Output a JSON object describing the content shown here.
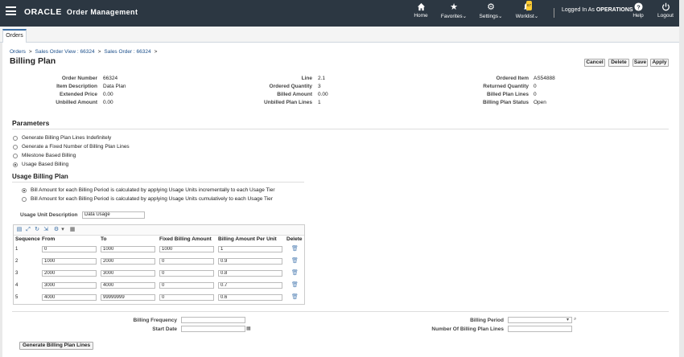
{
  "header": {
    "app_brand": "ORACLE",
    "app_name": "Order Management",
    "nav": [
      {
        "label": "Home",
        "icon": "home-icon"
      },
      {
        "label": "Favorites",
        "icon": "star-icon"
      },
      {
        "label": "Settings",
        "icon": "gear-icon"
      },
      {
        "label": "Worklist",
        "icon": "bell-icon",
        "badge": "67"
      },
      {
        "label": "Help",
        "icon": "help-icon"
      },
      {
        "label": "Logout",
        "icon": "power-icon"
      }
    ],
    "logged_in_prefix": "Logged In As",
    "logged_in_user": "OPERATIONS"
  },
  "tabs": [
    {
      "label": "Orders"
    }
  ],
  "breadcrumb": [
    "Orders",
    "Sales Order View : 66324",
    "Sales Order : 66324"
  ],
  "page_title": "Billing Plan",
  "toolbar": {
    "cancel": "Cancel",
    "delete": "Delete",
    "save": "Save",
    "apply": "Apply"
  },
  "info": {
    "col1": [
      {
        "label": "Order Number",
        "value": "66324"
      },
      {
        "label": "Item Description",
        "value": "Data Plan"
      },
      {
        "label": "Extended Price",
        "value": "0.00"
      },
      {
        "label": "Unbilled Amount",
        "value": "0.00"
      }
    ],
    "col2": [
      {
        "label": "Line",
        "value": "2.1"
      },
      {
        "label": "Ordered Quantity",
        "value": "3"
      },
      {
        "label": "Billed Amount",
        "value": "0.00"
      },
      {
        "label": "Unbilled Plan Lines",
        "value": "1"
      }
    ],
    "col3": [
      {
        "label": "Ordered Item",
        "value": "AS54888"
      },
      {
        "label": "Returned Quantity",
        "value": "0"
      },
      {
        "label": "Billed Plan Lines",
        "value": "0"
      },
      {
        "label": "Billing Plan Status",
        "value": "Open"
      }
    ]
  },
  "parameters": {
    "title": "Parameters",
    "options": [
      {
        "label": "Generate Billing Plan Lines Indefinitely",
        "selected": false
      },
      {
        "label": "Generate a Fixed Number of Billing Plan Lines",
        "selected": false
      },
      {
        "label": "Milestone Based Billing",
        "selected": false
      },
      {
        "label": "Usage Based Billing",
        "selected": true
      }
    ]
  },
  "usage_plan": {
    "title": "Usage Billing Plan",
    "options": [
      {
        "label": "Bill Amount for each Billing Period is calculated by applying Usage Units incrementally to each Usage Tier",
        "selected": true
      },
      {
        "label": "Bill Amount for each Billing Period is calculated by applying Usage Units cumulatively to each Usage Tier",
        "selected": false
      }
    ],
    "unit_desc_label": "Usage Unit Description",
    "unit_desc_value": "Data Usage"
  },
  "table": {
    "columns": [
      "Sequence",
      "From",
      "To",
      "Fixed Billing Amount",
      "Billing Amount Per Unit",
      "Delete"
    ],
    "rows": [
      {
        "seq": "1",
        "from": "0",
        "to": "1000",
        "fixed": "1000",
        "per_unit": "1"
      },
      {
        "seq": "2",
        "from": "1000",
        "to": "2000",
        "fixed": "0",
        "per_unit": "0.9"
      },
      {
        "seq": "3",
        "from": "2000",
        "to": "3000",
        "fixed": "0",
        "per_unit": "0.8"
      },
      {
        "seq": "4",
        "from": "3000",
        "to": "4000",
        "fixed": "0",
        "per_unit": "0.7"
      },
      {
        "seq": "5",
        "from": "4000",
        "to": "99999999",
        "fixed": "0",
        "per_unit": "0.6"
      }
    ]
  },
  "billing": {
    "frequency_label": "Billing Frequency",
    "frequency_value": "",
    "start_date_label": "Start Date",
    "start_date_value": "",
    "period_label": "Billing Period",
    "period_value": "",
    "num_lines_label": "Number Of Billing Plan Lines",
    "num_lines_value": ""
  },
  "generate_button": "Generate Billing Plan Lines"
}
